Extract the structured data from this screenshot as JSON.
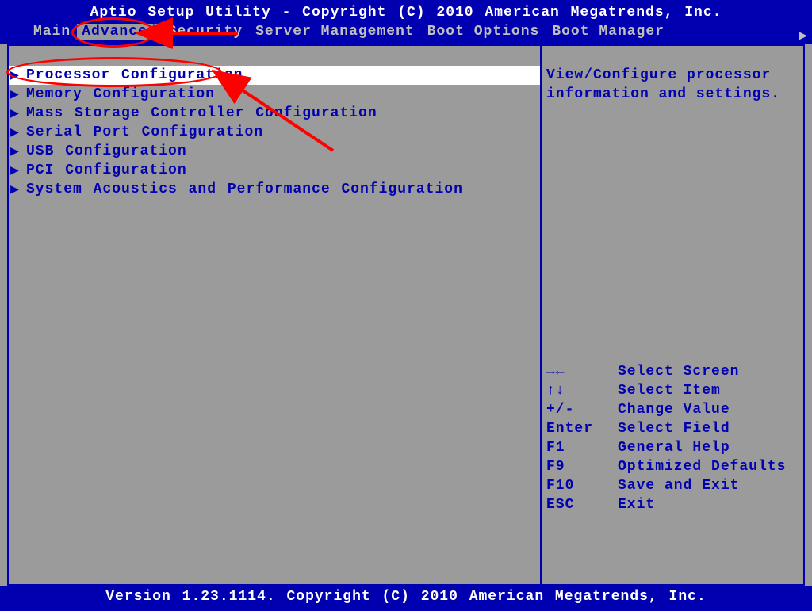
{
  "header": {
    "title": "Aptio Setup Utility - Copyright (C) 2010 American Megatrends, Inc.",
    "tabs": [
      {
        "label": "Main",
        "selected": false
      },
      {
        "label": "Advanced",
        "selected": true
      },
      {
        "label": "Security",
        "selected": false
      },
      {
        "label": "Server Management",
        "selected": false
      },
      {
        "label": "Boot Options",
        "selected": false
      },
      {
        "label": "Boot Manager",
        "selected": false
      }
    ],
    "scroll_indicator": "▶"
  },
  "menu": {
    "items": [
      {
        "label": "Processor Configuration",
        "selected": true
      },
      {
        "label": "Memory Configuration",
        "selected": false
      },
      {
        "label": "Mass Storage Controller Configuration",
        "selected": false
      },
      {
        "label": "Serial Port Configuration",
        "selected": false
      },
      {
        "label": "USB Configuration",
        "selected": false
      },
      {
        "label": "PCI Configuration",
        "selected": false
      },
      {
        "label": "System Acoustics and Performance Configuration",
        "selected": false
      }
    ]
  },
  "help": {
    "text_line1": "View/Configure processor",
    "text_line2": "information and settings."
  },
  "keys": [
    {
      "key": "→←",
      "action": "Select Screen"
    },
    {
      "key": "↑↓",
      "action": "Select Item"
    },
    {
      "key": "+/-",
      "action": "Change Value"
    },
    {
      "key": "Enter",
      "action": "Select Field"
    },
    {
      "key": "F1",
      "action": "General Help"
    },
    {
      "key": "F9",
      "action": "Optimized Defaults"
    },
    {
      "key": "F10",
      "action": "Save and Exit"
    },
    {
      "key": "ESC",
      "action": "Exit"
    }
  ],
  "footer": {
    "text": "Version 1.23.1114. Copyright (C) 2010 American Megatrends, Inc."
  },
  "annotations": {
    "circle_tab": "Advanced",
    "circle_item": "Processor Configuration"
  }
}
